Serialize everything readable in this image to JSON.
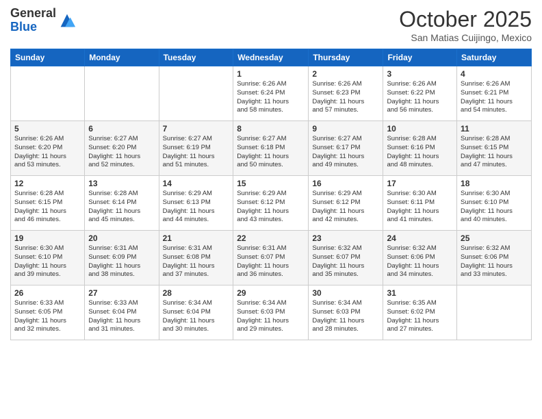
{
  "logo": {
    "general": "General",
    "blue": "Blue"
  },
  "header": {
    "month": "October 2025",
    "location": "San Matias Cuijingo, Mexico"
  },
  "days_of_week": [
    "Sunday",
    "Monday",
    "Tuesday",
    "Wednesday",
    "Thursday",
    "Friday",
    "Saturday"
  ],
  "weeks": [
    [
      {
        "day": "",
        "info": ""
      },
      {
        "day": "",
        "info": ""
      },
      {
        "day": "",
        "info": ""
      },
      {
        "day": "1",
        "info": "Sunrise: 6:26 AM\nSunset: 6:24 PM\nDaylight: 11 hours\nand 58 minutes."
      },
      {
        "day": "2",
        "info": "Sunrise: 6:26 AM\nSunset: 6:23 PM\nDaylight: 11 hours\nand 57 minutes."
      },
      {
        "day": "3",
        "info": "Sunrise: 6:26 AM\nSunset: 6:22 PM\nDaylight: 11 hours\nand 56 minutes."
      },
      {
        "day": "4",
        "info": "Sunrise: 6:26 AM\nSunset: 6:21 PM\nDaylight: 11 hours\nand 54 minutes."
      }
    ],
    [
      {
        "day": "5",
        "info": "Sunrise: 6:26 AM\nSunset: 6:20 PM\nDaylight: 11 hours\nand 53 minutes."
      },
      {
        "day": "6",
        "info": "Sunrise: 6:27 AM\nSunset: 6:20 PM\nDaylight: 11 hours\nand 52 minutes."
      },
      {
        "day": "7",
        "info": "Sunrise: 6:27 AM\nSunset: 6:19 PM\nDaylight: 11 hours\nand 51 minutes."
      },
      {
        "day": "8",
        "info": "Sunrise: 6:27 AM\nSunset: 6:18 PM\nDaylight: 11 hours\nand 50 minutes."
      },
      {
        "day": "9",
        "info": "Sunrise: 6:27 AM\nSunset: 6:17 PM\nDaylight: 11 hours\nand 49 minutes."
      },
      {
        "day": "10",
        "info": "Sunrise: 6:28 AM\nSunset: 6:16 PM\nDaylight: 11 hours\nand 48 minutes."
      },
      {
        "day": "11",
        "info": "Sunrise: 6:28 AM\nSunset: 6:15 PM\nDaylight: 11 hours\nand 47 minutes."
      }
    ],
    [
      {
        "day": "12",
        "info": "Sunrise: 6:28 AM\nSunset: 6:15 PM\nDaylight: 11 hours\nand 46 minutes."
      },
      {
        "day": "13",
        "info": "Sunrise: 6:28 AM\nSunset: 6:14 PM\nDaylight: 11 hours\nand 45 minutes."
      },
      {
        "day": "14",
        "info": "Sunrise: 6:29 AM\nSunset: 6:13 PM\nDaylight: 11 hours\nand 44 minutes."
      },
      {
        "day": "15",
        "info": "Sunrise: 6:29 AM\nSunset: 6:12 PM\nDaylight: 11 hours\nand 43 minutes."
      },
      {
        "day": "16",
        "info": "Sunrise: 6:29 AM\nSunset: 6:12 PM\nDaylight: 11 hours\nand 42 minutes."
      },
      {
        "day": "17",
        "info": "Sunrise: 6:30 AM\nSunset: 6:11 PM\nDaylight: 11 hours\nand 41 minutes."
      },
      {
        "day": "18",
        "info": "Sunrise: 6:30 AM\nSunset: 6:10 PM\nDaylight: 11 hours\nand 40 minutes."
      }
    ],
    [
      {
        "day": "19",
        "info": "Sunrise: 6:30 AM\nSunset: 6:10 PM\nDaylight: 11 hours\nand 39 minutes."
      },
      {
        "day": "20",
        "info": "Sunrise: 6:31 AM\nSunset: 6:09 PM\nDaylight: 11 hours\nand 38 minutes."
      },
      {
        "day": "21",
        "info": "Sunrise: 6:31 AM\nSunset: 6:08 PM\nDaylight: 11 hours\nand 37 minutes."
      },
      {
        "day": "22",
        "info": "Sunrise: 6:31 AM\nSunset: 6:07 PM\nDaylight: 11 hours\nand 36 minutes."
      },
      {
        "day": "23",
        "info": "Sunrise: 6:32 AM\nSunset: 6:07 PM\nDaylight: 11 hours\nand 35 minutes."
      },
      {
        "day": "24",
        "info": "Sunrise: 6:32 AM\nSunset: 6:06 PM\nDaylight: 11 hours\nand 34 minutes."
      },
      {
        "day": "25",
        "info": "Sunrise: 6:32 AM\nSunset: 6:06 PM\nDaylight: 11 hours\nand 33 minutes."
      }
    ],
    [
      {
        "day": "26",
        "info": "Sunrise: 6:33 AM\nSunset: 6:05 PM\nDaylight: 11 hours\nand 32 minutes."
      },
      {
        "day": "27",
        "info": "Sunrise: 6:33 AM\nSunset: 6:04 PM\nDaylight: 11 hours\nand 31 minutes."
      },
      {
        "day": "28",
        "info": "Sunrise: 6:34 AM\nSunset: 6:04 PM\nDaylight: 11 hours\nand 30 minutes."
      },
      {
        "day": "29",
        "info": "Sunrise: 6:34 AM\nSunset: 6:03 PM\nDaylight: 11 hours\nand 29 minutes."
      },
      {
        "day": "30",
        "info": "Sunrise: 6:34 AM\nSunset: 6:03 PM\nDaylight: 11 hours\nand 28 minutes."
      },
      {
        "day": "31",
        "info": "Sunrise: 6:35 AM\nSunset: 6:02 PM\nDaylight: 11 hours\nand 27 minutes."
      },
      {
        "day": "",
        "info": ""
      }
    ]
  ]
}
